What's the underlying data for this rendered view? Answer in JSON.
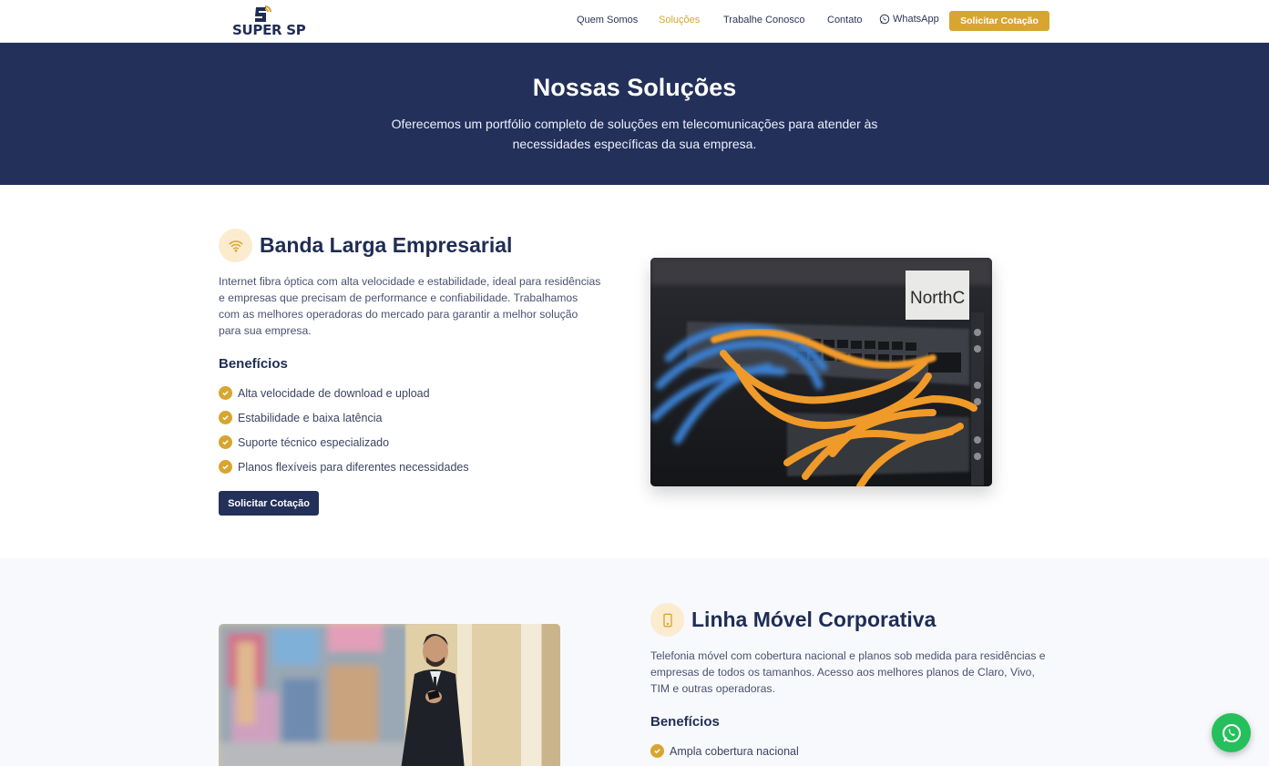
{
  "brand": {
    "name": "SUPER SP",
    "accent": "#d8a530",
    "navy": "#22305a"
  },
  "nav": {
    "items": [
      {
        "label": "Quem Somos",
        "active": false
      },
      {
        "label": "Soluções",
        "active": true
      },
      {
        "label": "Trabalhe Conosco",
        "active": false
      },
      {
        "label": "Contato",
        "active": false
      }
    ],
    "whatsapp_label": "WhatsApp",
    "cta_label": "Solicitar Cotação"
  },
  "hero": {
    "title": "Nossas Soluções",
    "subtitle": "Oferecemos um portfólio completo de soluções em telecomunicações para atender às necessidades específicas da sua empresa."
  },
  "solutions": [
    {
      "icon": "wifi-icon",
      "title": "Banda Larga Empresarial",
      "description": "Internet fibra óptica com alta velocidade e estabilidade, ideal para residências e empresas que precisam de performance e confiabilidade. Trabalhamos com as melhores operadoras do mercado para garantir a melhor solução para sua empresa.",
      "benefits_title": "Benefícios",
      "benefits": [
        "Alta velocidade de download e upload",
        "Estabilidade e baixa latência",
        "Suporte técnico especializado",
        "Planos flexíveis para diferentes necessidades"
      ],
      "button_label": "Solicitar Cotação",
      "image_label": "NorthC"
    },
    {
      "icon": "smartphone-icon",
      "title": "Linha Móvel Corporativa",
      "description": "Telefonia móvel com cobertura nacional e planos sob medida para residências e empresas de todos os tamanhos. Acesso aos melhores planos de Claro, Vivo, TIM e outras operadoras.",
      "benefits_title": "Benefícios",
      "benefits": [
        "Ampla cobertura nacional"
      ]
    }
  ]
}
